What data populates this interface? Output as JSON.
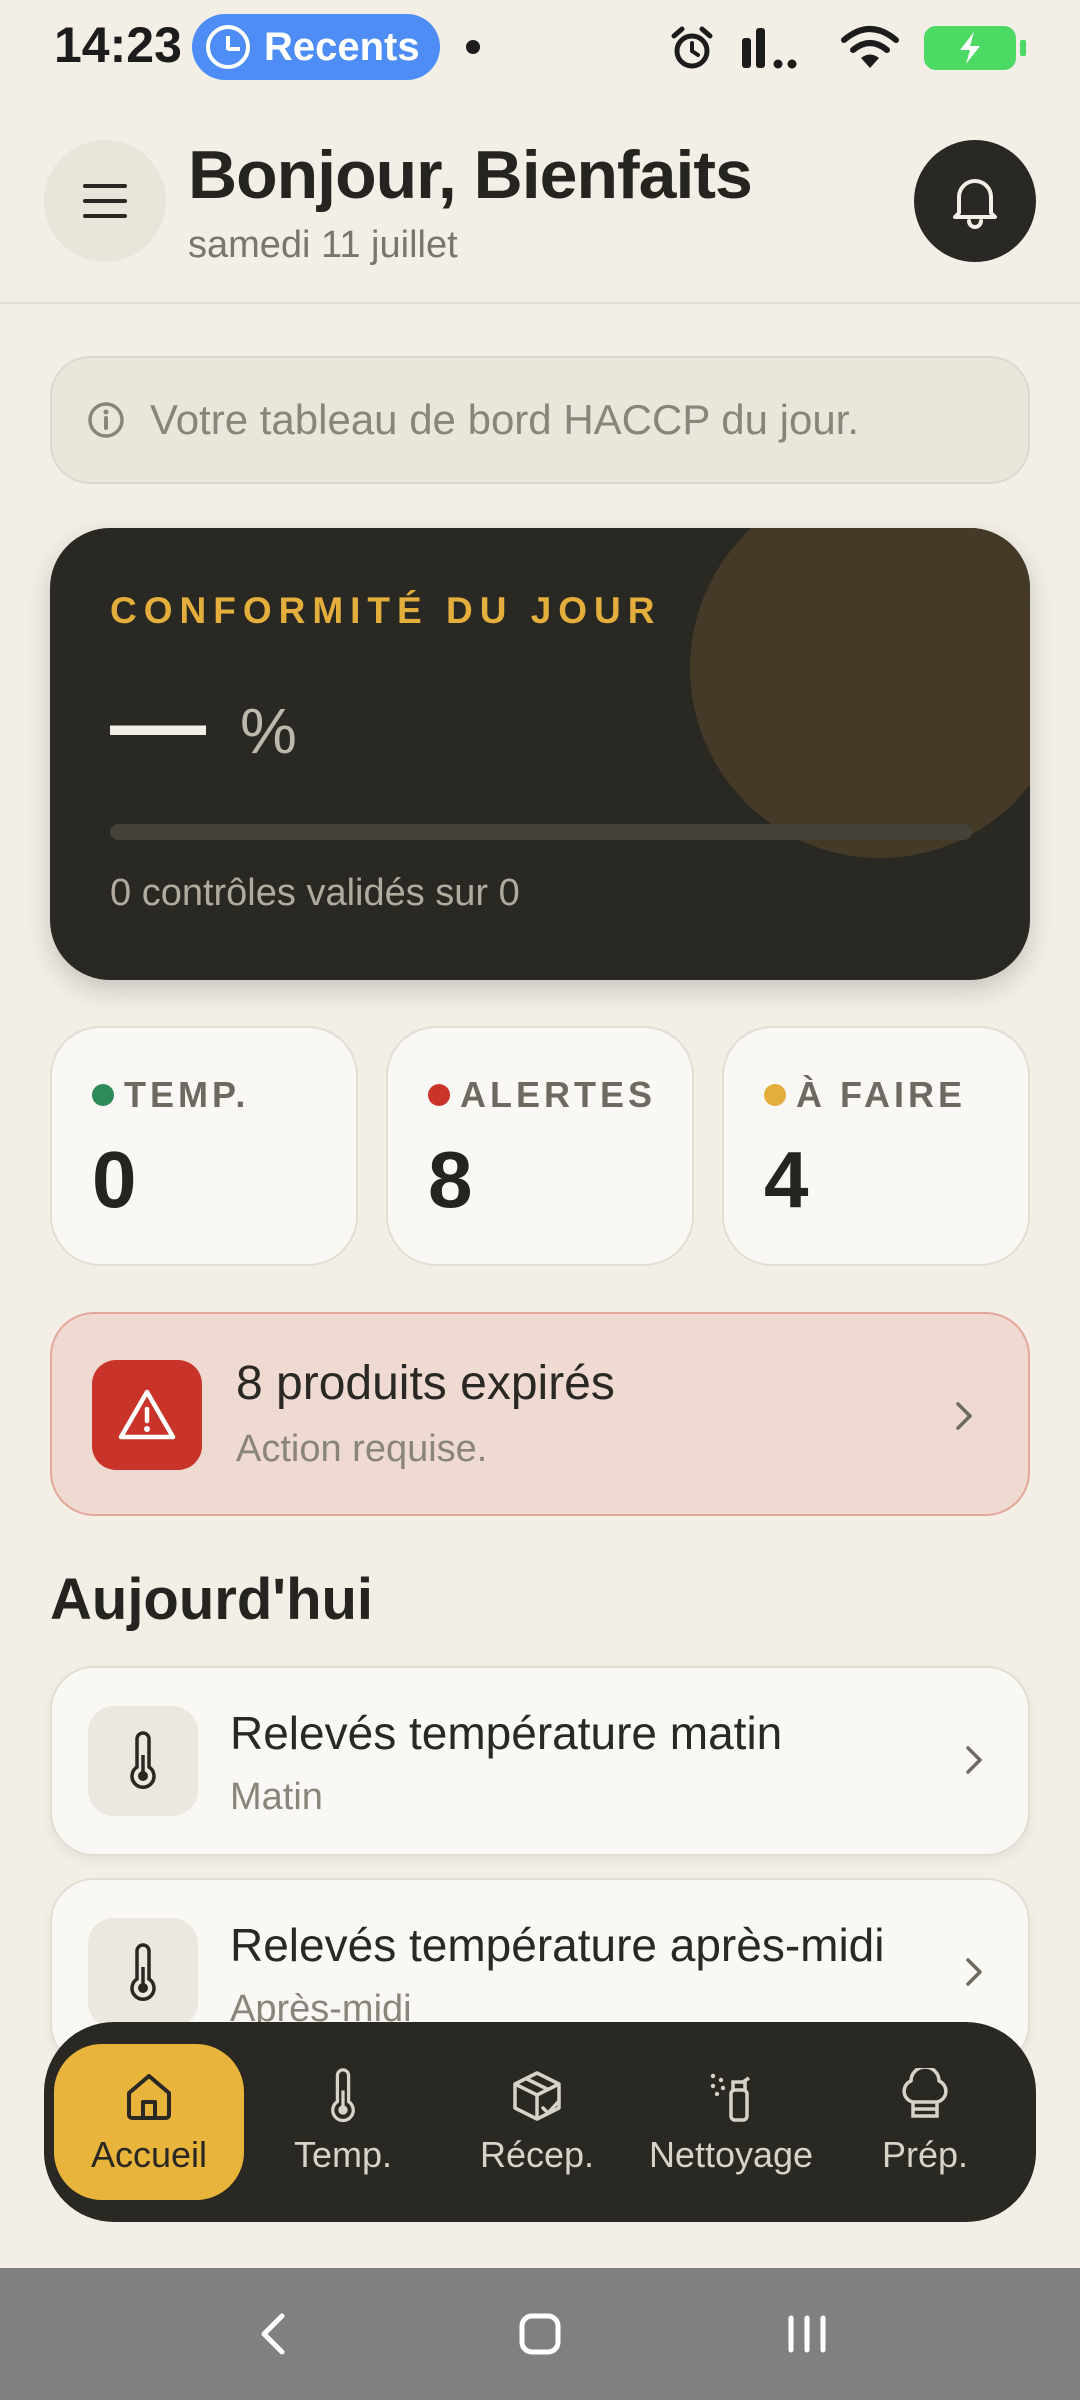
{
  "status_bar": {
    "time": "14:23",
    "recents_label": "Recents"
  },
  "header": {
    "title": "Bonjour, Bienfaits",
    "date": "samedi 11 juillet"
  },
  "info_banner": {
    "text": "Votre tableau de bord HACCP du jour."
  },
  "compliance": {
    "label": "CONFORMITÉ DU JOUR",
    "value": "—",
    "unit": "%",
    "progress": 0,
    "caption": "0 contrôles validés sur 0",
    "accent_color": "#E3AE3B"
  },
  "stats": [
    {
      "label": "TEMP.",
      "value": "0",
      "dot_color": "#2E8B57"
    },
    {
      "label": "ALERTES",
      "value": "8",
      "dot_color": "#C9342A"
    },
    {
      "label": "À FAIRE",
      "value": "4",
      "dot_color": "#E3AE3B"
    }
  ],
  "alert": {
    "title": "8 produits expirés",
    "subtitle": "Action requise.",
    "icon": "warning-icon"
  },
  "today": {
    "title": "Aujourd'hui",
    "tasks": [
      {
        "title": "Relevés température matin",
        "subtitle": "Matin",
        "icon": "thermometer-icon"
      },
      {
        "title": "Relevés température après-midi",
        "subtitle": "Après-midi",
        "icon": "thermometer-icon"
      }
    ]
  },
  "bottom_nav": {
    "items": [
      {
        "label": "Accueil",
        "icon": "home-icon",
        "active": true
      },
      {
        "label": "Temp.",
        "icon": "thermometer-icon"
      },
      {
        "label": "Récep.",
        "icon": "box-check-icon"
      },
      {
        "label": "Nettoyage",
        "icon": "spray-icon"
      },
      {
        "label": "Prép.",
        "icon": "chef-hat-icon"
      }
    ]
  }
}
